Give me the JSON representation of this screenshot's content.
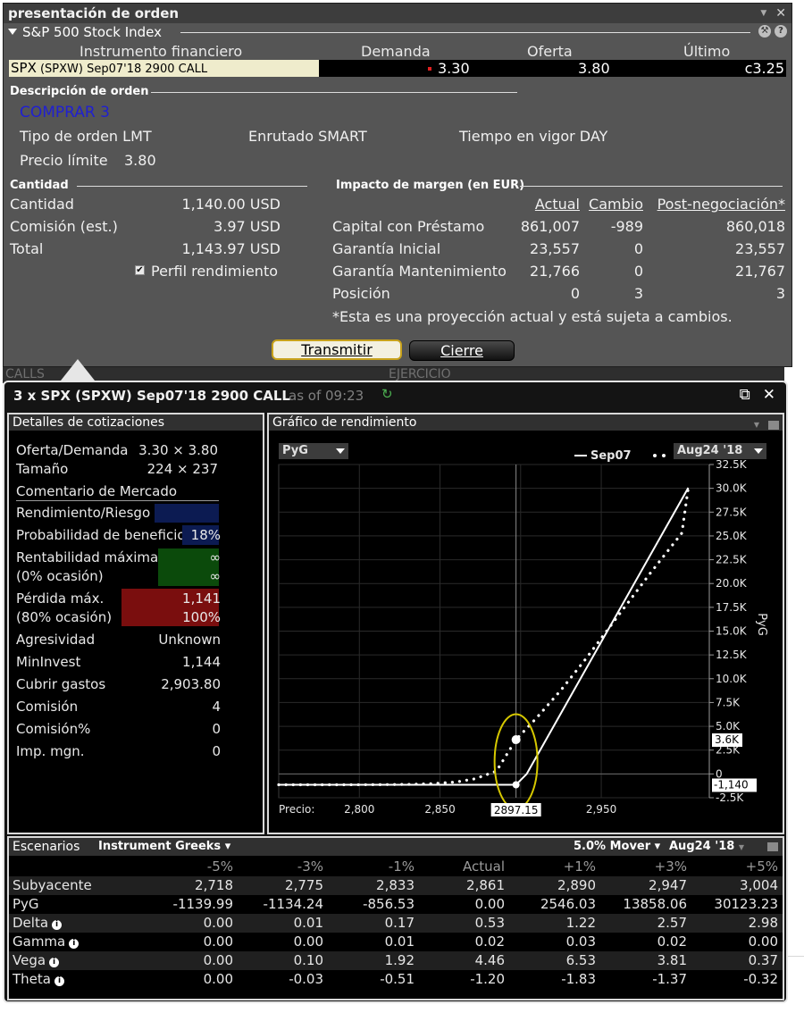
{
  "order": {
    "title": "presentación de orden",
    "subtitle": "S&P 500 Stock Index",
    "quote_headers": {
      "instrument": "Instrumento financiero",
      "bid": "Demanda",
      "ask": "Oferta",
      "last": "Último"
    },
    "quote": {
      "instrument_main": "SPX",
      "instrument_sub": "(SPXW) Sep07'18 2900 CALL",
      "bid": "3.30",
      "ask": "3.80",
      "last": "c3.25"
    },
    "description_title": "Descripción de orden",
    "action": "COMPRAR 3",
    "order_type": "Tipo de orden LMT",
    "routing": "Enrutado SMART",
    "tif": "Tiempo en vigor DAY",
    "limit_label": "Precio límite",
    "limit_value": "3.80",
    "quantity_title": "Cantidad",
    "quantity_rows": [
      {
        "label": "Cantidad",
        "value": "1,140.00 USD"
      },
      {
        "label": "Comisión (est.)",
        "value": "3.97 USD"
      },
      {
        "label": "Total",
        "value": "1,143.97 USD"
      }
    ],
    "profile_checkbox": "Perfil rendimiento",
    "margin_title": "Impacto de margen (en EUR)",
    "margin_headers": [
      "Actual",
      "Cambio",
      "Post-negociación*"
    ],
    "margin_rows": [
      {
        "label": "Capital con Préstamo",
        "actual": "861,007",
        "change": "-989",
        "post": "860,018"
      },
      {
        "label": "Garantía Inicial",
        "actual": "23,557",
        "change": "0",
        "post": "23,557"
      },
      {
        "label": "Garantía Mantenimiento",
        "actual": "21,766",
        "change": "0",
        "post": "21,767"
      },
      {
        "label": "Posición",
        "actual": "0",
        "change": "3",
        "post": "3"
      }
    ],
    "disclaimer": "*Esta es una proyección actual y está sujeta a cambios.",
    "transmit_label": "Transmitir",
    "close_label": "Cierre"
  },
  "background": {
    "calls": "CALLS",
    "exercise": "EJERCICIO"
  },
  "perf": {
    "title": "3 x SPX (SPXW) Sep07'18 2900 CALL",
    "as_of": "as of 09:23",
    "details_title": "Detalles de cotizaciones",
    "bid_ask_label": "Oferta/Demanda",
    "bid_ask_value": "3.30 × 3.80",
    "size_label": "Tamaño",
    "size_value": "224 × 237",
    "market_comment": "Comentario de Mercado",
    "risk_reward": "Rendimiento/Riesgo",
    "prob_label": "Probabilidad de beneficio",
    "prob_value": "18%",
    "max_profit_label": "Rentabilidad máxima",
    "max_profit_sub": "(0% ocasión)",
    "max_profit_value": "∞",
    "max_profit_value2": "∞",
    "max_loss_label": "Pérdida máx.",
    "max_loss_sub": "(80% ocasión)",
    "max_loss_value": "1,141",
    "max_loss_pct": "100%",
    "details_rows": [
      {
        "label": "Agresividad",
        "value": "Unknown"
      },
      {
        "label": "MinInvest",
        "value": "1,144"
      },
      {
        "label": "Cubrir gastos",
        "value": "2,903.80"
      },
      {
        "label": "Comisión",
        "value": "4"
      },
      {
        "label": "Comisión%",
        "value": "0"
      },
      {
        "label": "Imp. mgn.",
        "value": "0"
      }
    ],
    "chart_title": "Gráfico de rendimiento",
    "chart_metric": "PyG",
    "legend_solid": "Sep07",
    "legend_date": "Aug24 '18",
    "price_label": "Precio:",
    "price_cursor": "2897.15",
    "flag_upper": "3.6K",
    "flag_lower": "-1,140",
    "scen_title": "Escenarios",
    "scen_greeks": "Instrument Greeks",
    "scen_mover": "5.0% Mover",
    "scen_date": "Aug24 '18",
    "scen_headers": [
      "-5%",
      "-3%",
      "-1%",
      "Actual",
      "+1%",
      "+3%",
      "+5%"
    ],
    "scen_rows": [
      {
        "label": "Subyacente",
        "info": false,
        "values": [
          "2,718",
          "2,775",
          "2,833",
          "2,861",
          "2,890",
          "2,947",
          "3,004"
        ]
      },
      {
        "label": "PyG",
        "info": false,
        "values": [
          "-1139.99",
          "-1134.24",
          "-856.53",
          "0.00",
          "2546.03",
          "13858.06",
          "30123.23"
        ]
      },
      {
        "label": "Delta",
        "info": true,
        "values": [
          "0.00",
          "0.01",
          "0.17",
          "0.53",
          "1.22",
          "2.57",
          "2.98"
        ]
      },
      {
        "label": "Gamma",
        "info": true,
        "values": [
          "0.00",
          "0.00",
          "0.01",
          "0.02",
          "0.03",
          "0.02",
          "0.00"
        ]
      },
      {
        "label": "Vega",
        "info": true,
        "values": [
          "0.00",
          "0.10",
          "1.92",
          "4.46",
          "6.53",
          "3.81",
          "0.37"
        ]
      },
      {
        "label": "Theta",
        "info": true,
        "values": [
          "0.00",
          "-0.03",
          "-0.51",
          "-1.20",
          "-1.83",
          "-1.37",
          "-0.32"
        ]
      }
    ]
  },
  "chart_data": {
    "type": "line",
    "ylabel": "PyG",
    "x_range": [
      2750,
      3017
    ],
    "y_range": [
      -2500,
      32500
    ],
    "x_ticks": [
      2800,
      2850,
      2900,
      2950
    ],
    "x_tick_labels": [
      "2,800",
      "2,850",
      "",
      "2,950"
    ],
    "y_ticks": [
      -2500,
      0,
      2500,
      5000,
      7500,
      10000,
      12500,
      15000,
      17500,
      20000,
      22500,
      25000,
      27500,
      30000,
      32500
    ],
    "y_tick_labels": [
      "-2.5K",
      "0",
      "2.5K",
      "5.0K",
      "7.5K",
      "10.0K",
      "12.5K",
      "15.0K",
      "17.5K",
      "20.0K",
      "22.5K",
      "25.0K",
      "27.5K",
      "30.0K",
      "32.5K"
    ],
    "cursor_x": 2897.15,
    "highlight_point": {
      "x": 2897.15,
      "y": 3600
    },
    "series": [
      {
        "name": "Sep07",
        "style": "solid",
        "color": "#ffffff",
        "x": [
          2750,
          2800,
          2850,
          2880,
          2897.15,
          2903.8,
          2950,
          3000,
          3004
        ],
        "y": [
          -1140,
          -1140,
          -1140,
          -1140,
          -1140,
          0,
          13860,
          28860,
          30060
        ]
      },
      {
        "name": "Aug24 '18",
        "style": "dotted",
        "color": "#ffffff",
        "x": [
          2750,
          2780,
          2810,
          2830,
          2845,
          2860,
          2872,
          2885,
          2897.15,
          2910,
          2925,
          2940,
          2960,
          2980,
          3000,
          3004
        ],
        "y": [
          -1140,
          -1138,
          -1130,
          -1100,
          -1030,
          -850,
          -500,
          300,
          3600,
          5900,
          8800,
          12000,
          16500,
          21000,
          25300,
          30100
        ]
      }
    ],
    "highlight_ellipse_color": "#d6c800",
    "grid": true,
    "legend": "top-right"
  }
}
